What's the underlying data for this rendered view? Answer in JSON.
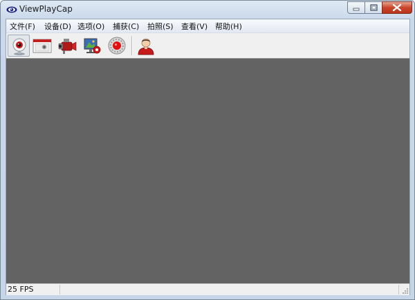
{
  "window": {
    "title": "ViewPlayCap",
    "icon": "eye-icon"
  },
  "menu": {
    "items": [
      {
        "label": "文件(F)"
      },
      {
        "label": "设备(D)"
      },
      {
        "label": "选项(O)"
      },
      {
        "label": "捕获(C)"
      },
      {
        "label": "拍照(S)"
      },
      {
        "label": "查看(V)"
      },
      {
        "label": "帮助(H)"
      }
    ]
  },
  "toolbar": {
    "buttons": [
      {
        "icon": "webcam-icon",
        "pressed": true
      },
      {
        "icon": "video-window-icon",
        "pressed": false
      },
      {
        "icon": "camcorder-icon",
        "pressed": false
      },
      {
        "icon": "display-settings-icon",
        "pressed": false
      },
      {
        "icon": "record-icon",
        "pressed": false
      },
      {
        "icon": "user-icon",
        "pressed": false
      }
    ]
  },
  "status": {
    "fps": "25 FPS",
    "message": ""
  },
  "colors": {
    "video_background": "#636363",
    "accent_red": "#d0181c"
  }
}
